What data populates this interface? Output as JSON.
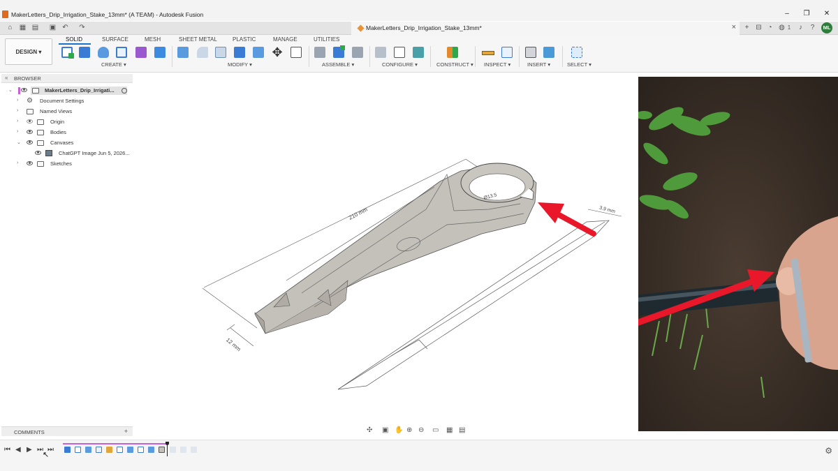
{
  "window": {
    "title": "MakerLetters_Drip_Irrigation_Stake_13mm* (A TEAM) - Autodesk Fusion",
    "controls": [
      "–",
      "❐",
      "✕"
    ]
  },
  "tabbar": {
    "doc_tab": "MakerLetters_Drip_Irrigation_Stake_13mm*",
    "right_count": "1",
    "avatar_initials": "ML"
  },
  "toolbar": {
    "workspace_button": "DESIGN ▾",
    "workspace_tabs": [
      "SOLID",
      "SURFACE",
      "MESH",
      "SHEET METAL",
      "PLASTIC",
      "MANAGE",
      "UTILITIES"
    ],
    "groups": [
      "CREATE ▾",
      "MODIFY ▾",
      "ASSEMBLE ▾",
      "CONFIGURE ▾",
      "CONSTRUCT ▾",
      "INSPECT ▾",
      "INSERT ▾",
      "SELECT ▾"
    ]
  },
  "browser": {
    "header": "BROWSER",
    "root": "MakerLetters_Drip_Irrigati...",
    "items": [
      {
        "label": "Document Settings",
        "icon": "gear-icon"
      },
      {
        "label": "Named Views",
        "icon": "folder-icon"
      },
      {
        "label": "Origin",
        "icon": "folder-icon"
      },
      {
        "label": "Bodies",
        "icon": "folder-icon"
      },
      {
        "label": "Canvases",
        "icon": "folder-icon"
      },
      {
        "label": "ChatGPT Image Jun 5, 2026...",
        "icon": "image-icon"
      },
      {
        "label": "Sketches",
        "icon": "folder-icon"
      }
    ]
  },
  "comments": {
    "label": "COMMENTS",
    "add": "+"
  },
  "model": {
    "dim_length": "210 mm",
    "dim_width": "12 mm",
    "dim_ring": "Ø13.5",
    "dim_thickness": "3.9 mm"
  },
  "colors": {
    "accent": "#1a73c8",
    "timeline": "#c861d8",
    "arrow": "#e8182a",
    "avatar": "#2f7d3c"
  }
}
